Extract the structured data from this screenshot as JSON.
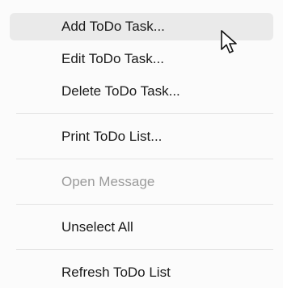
{
  "menu": {
    "items": [
      {
        "label": "Add ToDo Task...",
        "state": "hover"
      },
      {
        "label": "Edit ToDo Task...",
        "state": "normal"
      },
      {
        "label": "Delete ToDo Task...",
        "state": "normal"
      },
      {
        "label": "Print ToDo List...",
        "state": "normal"
      },
      {
        "label": "Open Message",
        "state": "disabled"
      },
      {
        "label": "Unselect All",
        "state": "normal"
      },
      {
        "label": "Refresh ToDo List",
        "state": "normal"
      }
    ]
  },
  "colors": {
    "menu_background": "#fbfbfb",
    "hover_background": "#eaeaea",
    "text": "#1a1a1a",
    "disabled_text": "#9b9b9b",
    "separator": "#e3e3e3"
  },
  "icons": {
    "cursor": "mouse-pointer-icon"
  }
}
